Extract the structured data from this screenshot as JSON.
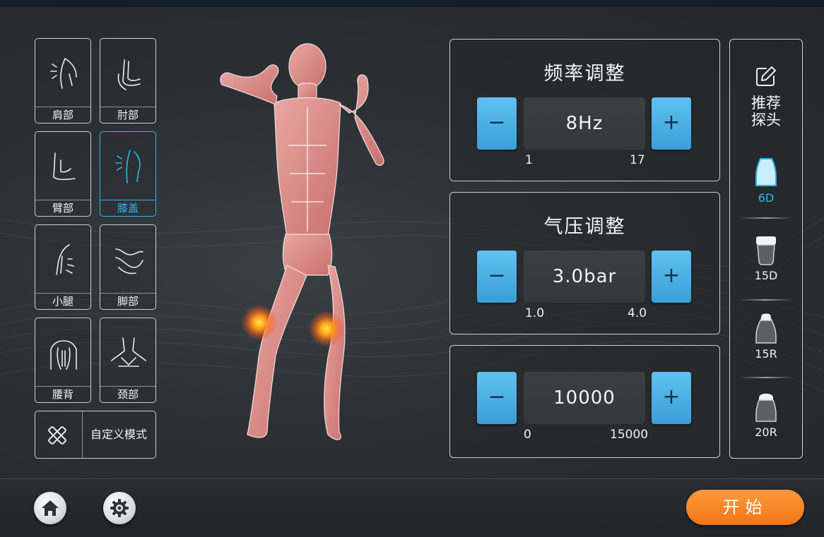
{
  "body_parts": [
    {
      "label": "肩部",
      "icon": "shoulder-icon",
      "active": false
    },
    {
      "label": "肘部",
      "icon": "elbow-icon",
      "active": false
    },
    {
      "label": "臂部",
      "icon": "arm-icon",
      "active": false
    },
    {
      "label": "膝盖",
      "icon": "knee-icon",
      "active": true
    },
    {
      "label": "小腿",
      "icon": "calf-icon",
      "active": false
    },
    {
      "label": "脚部",
      "icon": "foot-icon",
      "active": false
    },
    {
      "label": "腰背",
      "icon": "back-icon",
      "active": false
    },
    {
      "label": "颈部",
      "icon": "neck-icon",
      "active": false
    }
  ],
  "custom_mode": {
    "label": "自定义模式",
    "icon": "tools-icon"
  },
  "frequency": {
    "title": "频率调整",
    "value": "8Hz",
    "min": "1",
    "max": "17",
    "minus": "−",
    "plus": "+"
  },
  "pressure": {
    "title": "气压调整",
    "value": "3.0bar",
    "min": "1.0",
    "max": "4.0",
    "minus": "−",
    "plus": "+"
  },
  "count": {
    "value": "10000",
    "min": "0",
    "max": "15000",
    "minus": "−",
    "plus": "+"
  },
  "probes": {
    "heading_line1": "推荐",
    "heading_line2": "探头",
    "items": [
      {
        "label": "6D",
        "selected": true
      },
      {
        "label": "15D",
        "selected": false
      },
      {
        "label": "15R",
        "selected": false
      },
      {
        "label": "20R",
        "selected": false
      }
    ]
  },
  "start_label": "开始",
  "colors": {
    "accent": "#2ab6e8",
    "step_button": "#4fb3e6",
    "start": "#f5821f",
    "background": "#2c3034"
  }
}
